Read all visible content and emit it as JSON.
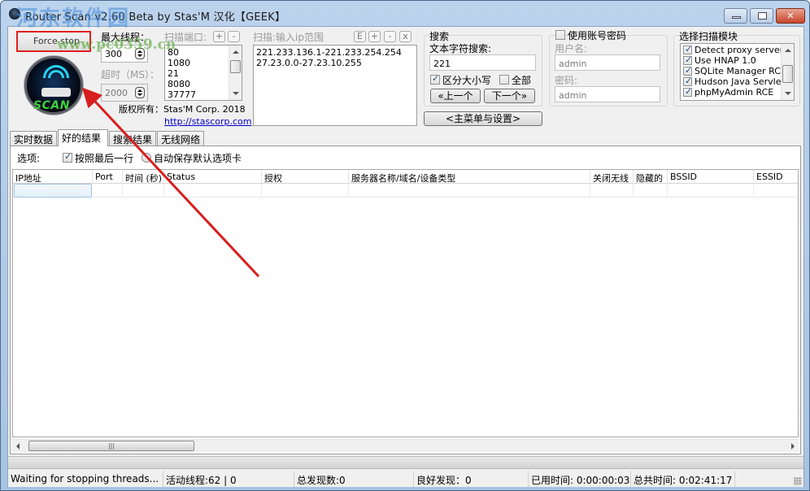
{
  "window": {
    "title": "Router Scan v2.60 Beta by Stas'M  汉化【GEEK】",
    "controls": {
      "minimize": "minimize",
      "maximize": "maximize",
      "close": "close"
    }
  },
  "watermark": {
    "site": "河东软件园",
    "url": "www.pc0359.cn"
  },
  "left_panel": {
    "force_stop_label": "Force stop",
    "logo_text": "SCAN",
    "max_threads_label": "最大线程：",
    "max_threads_value": "300",
    "timeout_label": "超时（MS）：",
    "timeout_value": "2000",
    "ports_label": "扫描端口:",
    "ports_add": "+",
    "ports_remove": "-",
    "ports": [
      "80",
      "1080",
      "21",
      "8080",
      "37777"
    ],
    "copyright": "版权所有：Stas'M Corp. 2018",
    "website": "http://stascorp.com"
  },
  "ip_range": {
    "label": "扫描:输入ip范围",
    "buttons": [
      "E",
      "+",
      "-",
      "x"
    ],
    "ranges": [
      "221.233.136.1-221.233.254.254",
      "27.23.0.0-27.23.10.255"
    ]
  },
  "search": {
    "group_label": "搜索",
    "text_label": "文本字符搜索:",
    "text_value": "221",
    "case_sensitive_label": "区分大小写",
    "case_sensitive_checked": true,
    "all_label": "全部",
    "all_checked": false,
    "prev_label": "«上一个",
    "next_label": "下一个»",
    "main_menu_label": "<主菜单与设置>"
  },
  "auth": {
    "use_credentials_label": "使用账号密码",
    "use_credentials_checked": false,
    "username_label": "用户名:",
    "username_value": "admin",
    "password_label": "密码:",
    "password_value": "admin"
  },
  "modules": {
    "label": "选择扫描模块",
    "items": [
      {
        "label": "Detect proxy servers",
        "checked": true
      },
      {
        "label": "Use HNAP 1.0",
        "checked": true
      },
      {
        "label": "SQLite Manager RCE",
        "checked": true
      },
      {
        "label": "Hudson Java Servlet",
        "checked": true
      },
      {
        "label": "phpMyAdmin RCE",
        "checked": true
      }
    ]
  },
  "tabs": [
    {
      "label": "实时数据",
      "active": false
    },
    {
      "label": "好的结果",
      "active": true
    },
    {
      "label": "搜索结果",
      "active": false
    },
    {
      "label": "无线网络",
      "active": false
    }
  ],
  "options": {
    "label": "选项:",
    "follow_last_row_label": "按照最后一行",
    "follow_last_row_checked": true,
    "autosave_label": "自动保存默认选项卡",
    "autosave_selected": false
  },
  "table": {
    "columns": [
      "IP地址",
      "Port",
      "时间 (秒)",
      "Status",
      "授权",
      "服务器名称/域名/设备类型",
      "关闭无线",
      "隐藏的",
      "BSSID",
      "ESSID"
    ],
    "rows": []
  },
  "status_bar": {
    "message": "Waiting for stopping threads...",
    "active_threads": "活动线程:62 | 0",
    "total_found": "总发现数:0",
    "good_found": "良好发现：0",
    "elapsed": "已用时间: 0:00:00:03",
    "total_time": "总共时间: 0:02:41:17"
  }
}
